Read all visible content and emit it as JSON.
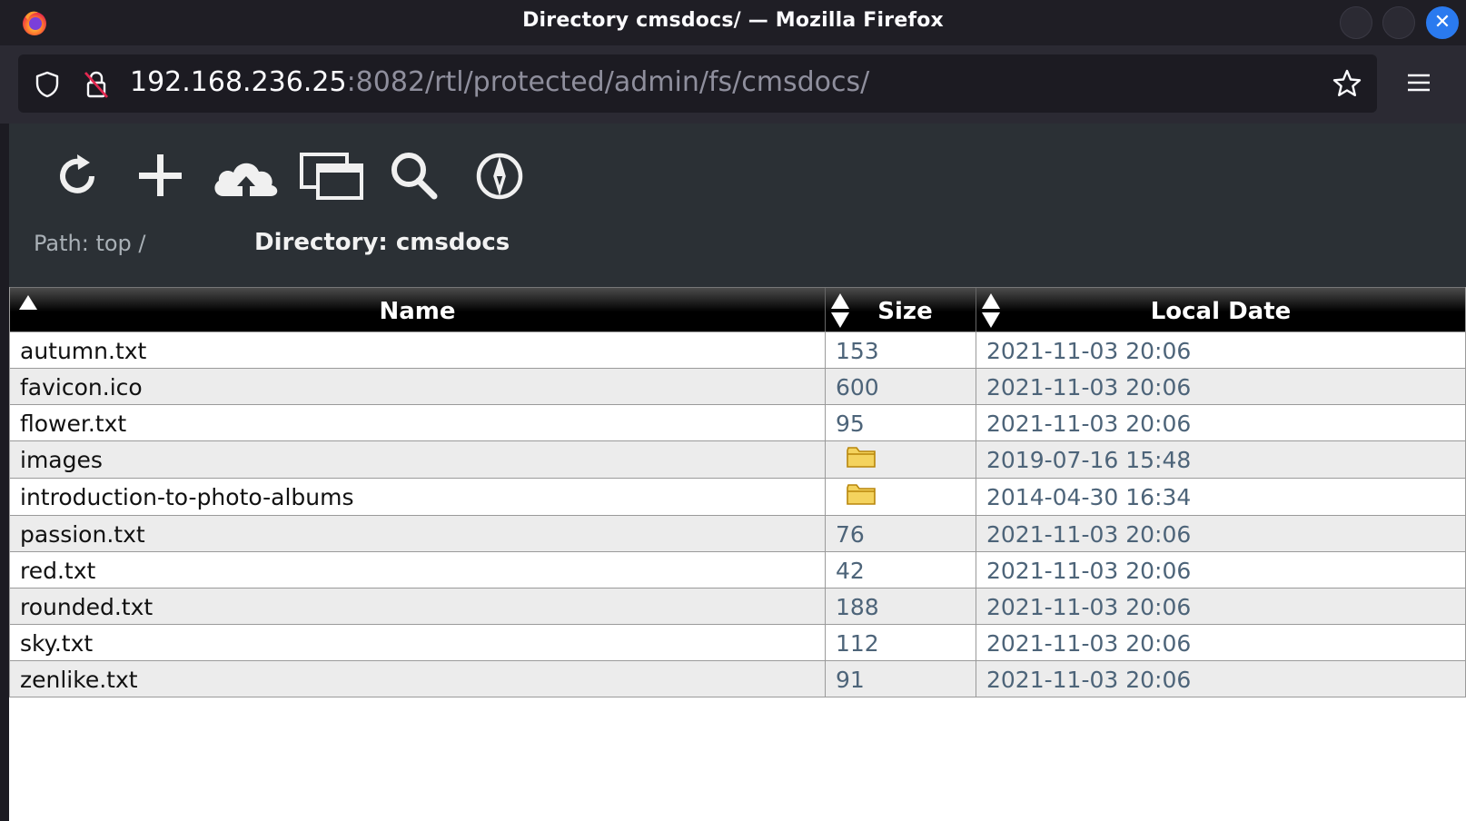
{
  "window": {
    "title": "Directory cmsdocs/ — Mozilla Firefox",
    "close_glyph": "✕"
  },
  "urlbar": {
    "host": "192.168.236.25",
    "path": ":8082/rtl/protected/admin/fs/cmsdocs/"
  },
  "toolbar": {
    "icons": [
      "refresh-icon",
      "add-icon",
      "upload-cloud-icon",
      "windows-icon",
      "search-icon",
      "compass-icon"
    ],
    "path_label": "Path: top /",
    "directory_label": "Directory: cmsdocs"
  },
  "table": {
    "headers": {
      "name": "Name",
      "size": "Size",
      "date": "Local Date"
    },
    "rows": [
      {
        "name": "autumn.txt",
        "size": "153",
        "date": "2021-11-03 20:06",
        "folder": false
      },
      {
        "name": "favicon.ico",
        "size": "600",
        "date": "2021-11-03 20:06",
        "folder": false
      },
      {
        "name": "flower.txt",
        "size": "95",
        "date": "2021-11-03 20:06",
        "folder": false
      },
      {
        "name": "images",
        "size": "",
        "date": "2019-07-16 15:48",
        "folder": true
      },
      {
        "name": "introduction-to-photo-albums",
        "size": "",
        "date": "2014-04-30 16:34",
        "folder": true
      },
      {
        "name": "passion.txt",
        "size": "76",
        "date": "2021-11-03 20:06",
        "folder": false
      },
      {
        "name": "red.txt",
        "size": "42",
        "date": "2021-11-03 20:06",
        "folder": false
      },
      {
        "name": "rounded.txt",
        "size": "188",
        "date": "2021-11-03 20:06",
        "folder": false
      },
      {
        "name": "sky.txt",
        "size": "112",
        "date": "2021-11-03 20:06",
        "folder": false
      },
      {
        "name": "zenlike.txt",
        "size": "91",
        "date": "2021-11-03 20:06",
        "folder": false
      }
    ]
  },
  "colors": {
    "accent": "#2a7aef",
    "header_bg": "#2b3035",
    "link_text": "#4d6479",
    "folder": "#e8c33c"
  }
}
